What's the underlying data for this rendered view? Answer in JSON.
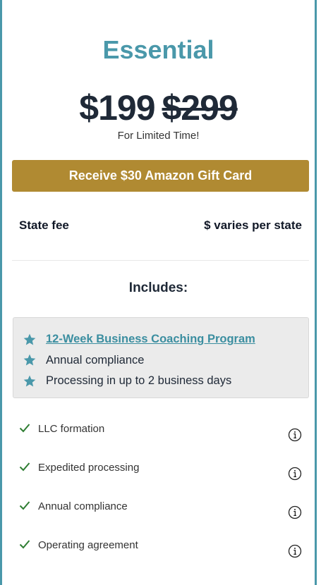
{
  "plan": {
    "title": "Essential",
    "price": "$199",
    "old_price": "$299",
    "limited_note": "For Limited Time!",
    "gift_button": "Receive $30 Amazon Gift Card"
  },
  "state_fee": {
    "label": "State fee",
    "value": "$ varies per state"
  },
  "includes": {
    "title": "Includes:",
    "items": [
      {
        "label": "12-Week Business Coaching Program",
        "icon": "star-icon",
        "is_link": true
      },
      {
        "label": "Annual compliance",
        "icon": "star-icon",
        "is_link": false
      },
      {
        "label": "Processing in up to 2 business days",
        "icon": "star-icon",
        "is_link": false
      }
    ]
  },
  "features": [
    {
      "label": "LLC formation",
      "icon": "check-icon",
      "info_icon": "info-icon"
    },
    {
      "label": "Expedited processing",
      "icon": "check-icon",
      "info_icon": "info-icon"
    },
    {
      "label": "Annual compliance",
      "icon": "check-icon",
      "info_icon": "info-icon"
    },
    {
      "label": "Operating agreement",
      "icon": "check-icon",
      "info_icon": "info-icon"
    }
  ],
  "colors": {
    "accent": "#4a98aa",
    "gift_button": "#b08a32",
    "check": "#2e7d32",
    "includes_bg": "#ebebeb"
  }
}
